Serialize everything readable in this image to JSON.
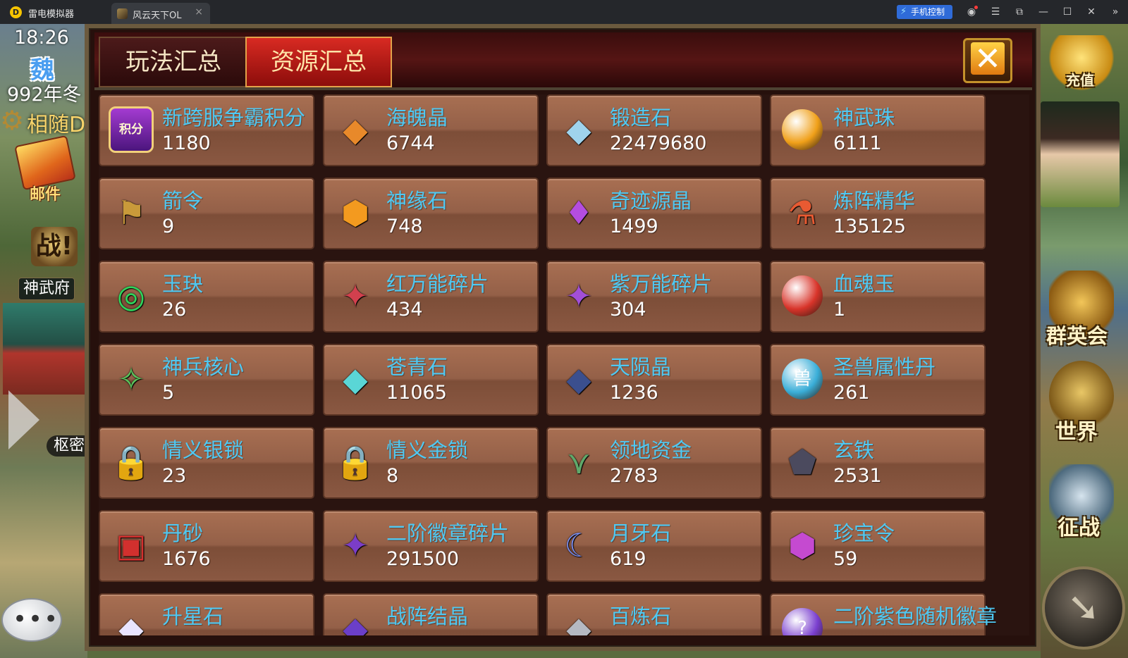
{
  "emulator": {
    "app_name": "雷电模拟器",
    "tab_title": "风云天下OL",
    "tab_close": "×",
    "phone_control": "手机控制",
    "controls": [
      "☰",
      "⧉",
      "—",
      "☐",
      "✕",
      "»"
    ]
  },
  "hud": {
    "time": "18:26",
    "kingdom": "魏",
    "season": "992年冬",
    "follow_label": "相随D",
    "mail_label": "邮件",
    "battle_label": "战!",
    "palace_label": "神武府",
    "secret_label": "枢密",
    "recharge_label": "充值",
    "heroes_label": "群英会",
    "world_label": "世界",
    "conquest_label": "征战"
  },
  "dialog": {
    "tabs": [
      "玩法汇总",
      "资源汇总"
    ],
    "active_tab": "资源汇总",
    "close_glyph": "✕"
  },
  "resources": [
    {
      "name": "新跨服争霸积分",
      "count": "1180",
      "icon": "points-badge-icon",
      "glyph": "积分",
      "color": "#a43bd1"
    },
    {
      "name": "海魄晶",
      "count": "6744",
      "icon": "sea-crystal-icon",
      "glyph": "◆",
      "color": "#e8892a"
    },
    {
      "name": "锻造石",
      "count": "22479680",
      "icon": "forge-stone-icon",
      "glyph": "◆",
      "color": "#9fd3ec"
    },
    {
      "name": "神武珠",
      "count": "6111",
      "icon": "divine-orb-icon",
      "glyph": "●",
      "color": "#f0a019"
    },
    {
      "name": "箭令",
      "count": "9",
      "icon": "arrow-token-icon",
      "glyph": "⚑",
      "color": "#c99a3a"
    },
    {
      "name": "神缘石",
      "count": "748",
      "icon": "fate-stone-icon",
      "glyph": "⬢",
      "color": "#f39a1f"
    },
    {
      "name": "奇迹源晶",
      "count": "1499",
      "icon": "miracle-crystal-icon",
      "glyph": "♦",
      "color": "#b44de0"
    },
    {
      "name": "炼阵精华",
      "count": "135125",
      "icon": "essence-flask-icon",
      "glyph": "⚗",
      "color": "#e85a32"
    },
    {
      "name": "玉玦",
      "count": "26",
      "icon": "jade-ring-icon",
      "glyph": "◎",
      "color": "#2fd35b"
    },
    {
      "name": "红万能碎片",
      "count": "434",
      "icon": "red-fragment-icon",
      "glyph": "✦",
      "color": "#d2404e"
    },
    {
      "name": "紫万能碎片",
      "count": "304",
      "icon": "purple-fragment-icon",
      "glyph": "✦",
      "color": "#a24fd8"
    },
    {
      "name": "血魂玉",
      "count": "1",
      "icon": "blood-jade-icon",
      "glyph": "●",
      "color": "#d8342a"
    },
    {
      "name": "神兵核心",
      "count": "5",
      "icon": "weapon-core-icon",
      "glyph": "✧",
      "color": "#5bc25b"
    },
    {
      "name": "苍青石",
      "count": "11065",
      "icon": "azure-stone-icon",
      "glyph": "◆",
      "color": "#5ad6d6"
    },
    {
      "name": "天陨晶",
      "count": "1236",
      "icon": "meteor-crystal-icon",
      "glyph": "◆",
      "color": "#3b4f8e"
    },
    {
      "name": "圣兽属性丹",
      "count": "261",
      "icon": "beast-pill-icon",
      "glyph": "兽",
      "color": "#3aaed8"
    },
    {
      "name": "情义银锁",
      "count": "23",
      "icon": "silver-lock-icon",
      "glyph": "🔒",
      "color": "#e8e8f0"
    },
    {
      "name": "情义金锁",
      "count": "8",
      "icon": "gold-lock-icon",
      "glyph": "🔒",
      "color": "#f0b21f"
    },
    {
      "name": "领地资金",
      "count": "2783",
      "icon": "territory-funds-icon",
      "glyph": "⋎",
      "color": "#5fa86a"
    },
    {
      "name": "玄铁",
      "count": "2531",
      "icon": "dark-iron-icon",
      "glyph": "⬟",
      "color": "#4b4a5e"
    },
    {
      "name": "丹砂",
      "count": "1676",
      "icon": "cinnabar-box-icon",
      "glyph": "▣",
      "color": "#d2302e"
    },
    {
      "name": "二阶徽章碎片",
      "count": "291500",
      "icon": "badge-fragment-icon",
      "glyph": "✦",
      "color": "#7b3dc8"
    },
    {
      "name": "月牙石",
      "count": "619",
      "icon": "crescent-stone-icon",
      "glyph": "☾",
      "color": "#7c8ff0"
    },
    {
      "name": "珍宝令",
      "count": "59",
      "icon": "treasure-token-icon",
      "glyph": "⬢",
      "color": "#c54ad0"
    },
    {
      "name": "升星石",
      "count": "",
      "icon": "star-stone-icon",
      "glyph": "◆",
      "color": "#e9e4ff"
    },
    {
      "name": "战阵结晶",
      "count": "",
      "icon": "formation-crystal-icon",
      "glyph": "◆",
      "color": "#6b3fc8"
    },
    {
      "name": "百炼石",
      "count": "",
      "icon": "refine-stone-icon",
      "glyph": "◆",
      "color": "#b5b9c2"
    },
    {
      "name": "二阶紫色随机徽章",
      "count": "",
      "icon": "purple-badge-icon",
      "glyph": "?",
      "color": "#7a3fcf"
    }
  ]
}
